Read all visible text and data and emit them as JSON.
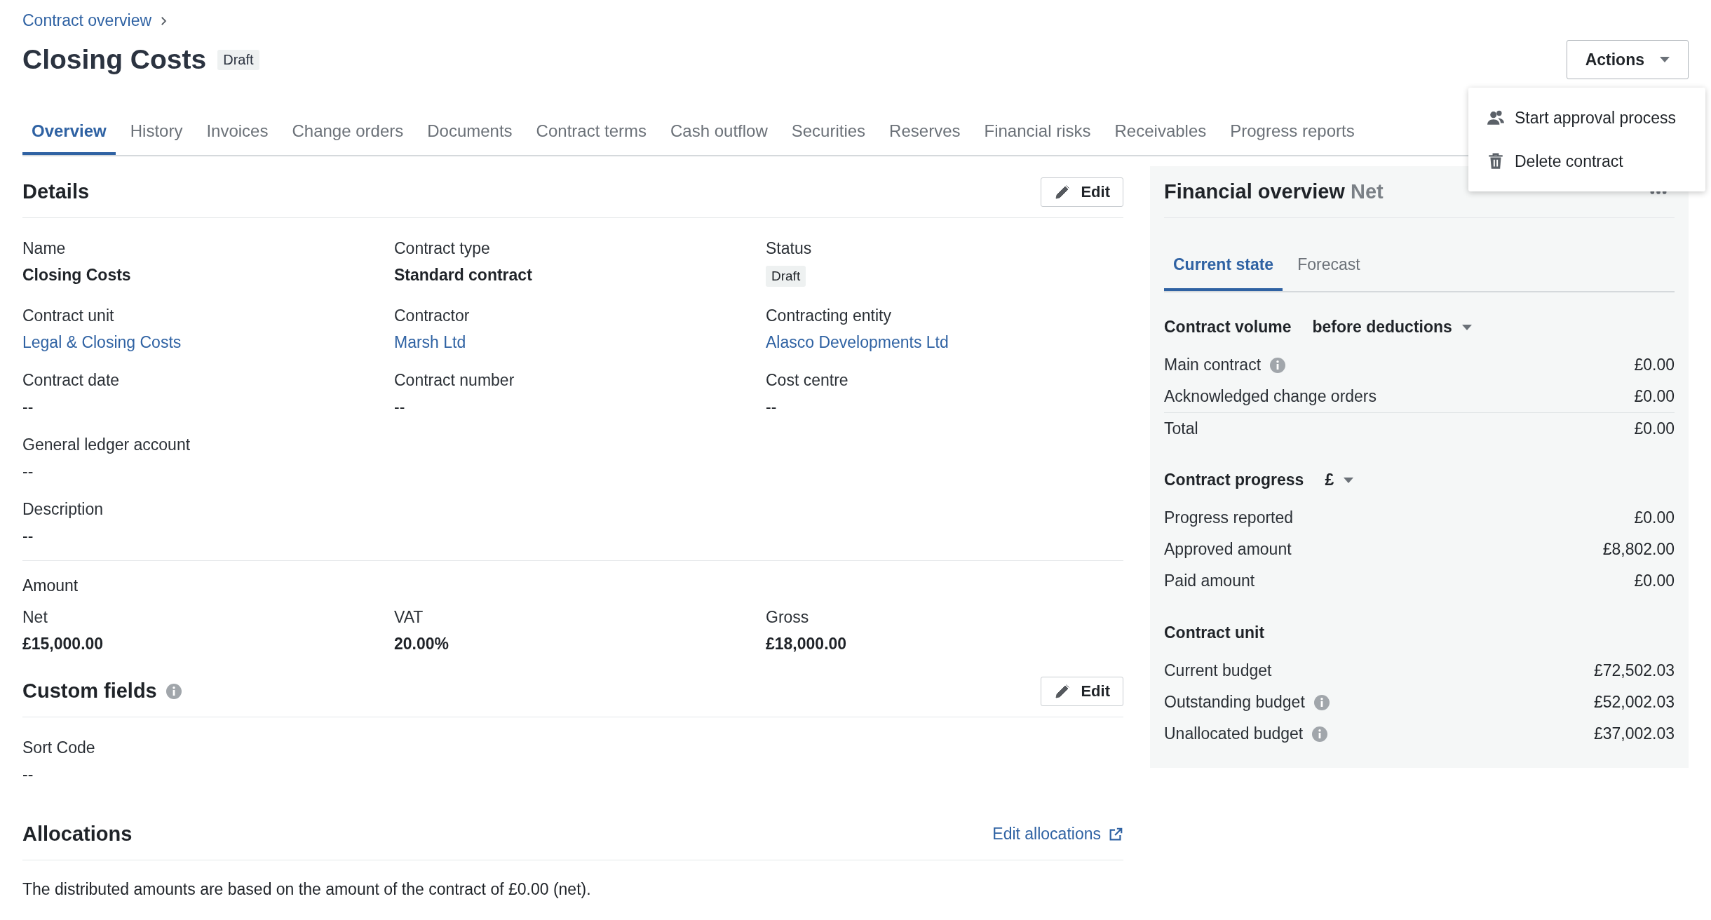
{
  "breadcrumb": {
    "label": "Contract overview"
  },
  "page_title": "Closing Costs",
  "status_badge": "Draft",
  "actions_button": {
    "label": "Actions",
    "expanded": true
  },
  "actions_menu": [
    {
      "label": "Start approval process",
      "kind": "approval"
    },
    {
      "label": "Delete contract",
      "kind": "delete"
    }
  ],
  "tabs": [
    {
      "label": "Overview",
      "selected": true
    },
    {
      "label": "History",
      "selected": false
    },
    {
      "label": "Invoices",
      "selected": false
    },
    {
      "label": "Change orders",
      "selected": false
    },
    {
      "label": "Documents",
      "selected": false
    },
    {
      "label": "Contract terms",
      "selected": false
    },
    {
      "label": "Cash outflow",
      "selected": false
    },
    {
      "label": "Securities",
      "selected": false
    },
    {
      "label": "Reserves",
      "selected": false
    },
    {
      "label": "Financial risks",
      "selected": false
    },
    {
      "label": "Receivables",
      "selected": false
    },
    {
      "label": "Progress reports",
      "selected": false
    }
  ],
  "details": {
    "title": "Details",
    "edit_label": "Edit",
    "rows": [
      [
        {
          "label": "Name",
          "value": "Closing Costs",
          "kind": "strong"
        },
        {
          "label": "Contract type",
          "value": "Standard contract",
          "kind": "strong"
        },
        {
          "label": "Status",
          "value": "Draft",
          "kind": "badge"
        }
      ],
      [
        {
          "label": "Contract unit",
          "value": "Legal & Closing Costs",
          "kind": "link"
        },
        {
          "label": "Contractor",
          "value": "Marsh Ltd",
          "kind": "link"
        },
        {
          "label": "Contracting entity",
          "value": "Alasco Developments Ltd",
          "kind": "link"
        }
      ],
      [
        {
          "label": "Contract date",
          "value": "--",
          "kind": "text"
        },
        {
          "label": "Contract number",
          "value": "--",
          "kind": "text"
        },
        {
          "label": "Cost centre",
          "value": "--",
          "kind": "text"
        }
      ],
      [
        {
          "label": "General ledger account",
          "value": "--",
          "kind": "text"
        }
      ],
      [
        {
          "label": "Description",
          "value": "--",
          "kind": "text"
        }
      ]
    ],
    "amount": {
      "title": "Amount",
      "fields": [
        {
          "label": "Net",
          "value": "£15,000.00",
          "kind": "strong"
        },
        {
          "label": "VAT",
          "value": "20.00%",
          "kind": "strong"
        },
        {
          "label": "Gross",
          "value": "£18,000.00",
          "kind": "strong"
        }
      ]
    }
  },
  "custom_fields": {
    "title": "Custom fields",
    "edit_label": "Edit",
    "fields": [
      {
        "label": "Sort Code",
        "value": "--"
      }
    ]
  },
  "allocations": {
    "title": "Allocations",
    "link": "Edit allocations",
    "text": "The distributed amounts are based on the amount of the contract of £0.00 (net)."
  },
  "financial_overview": {
    "title": "Financial overview",
    "qualifier": "Net",
    "tabs": [
      {
        "label": "Current state",
        "selected": true
      },
      {
        "label": "Forecast",
        "selected": false
      }
    ],
    "sections": [
      {
        "title": "Contract volume",
        "selector": "before deductions",
        "rows": [
          {
            "label": "Main contract",
            "value": "£0.00",
            "info": true,
            "kind": "line"
          },
          {
            "label": "Acknowledged change orders",
            "value": "£0.00",
            "info": false,
            "kind": "line"
          },
          {
            "label": "Total",
            "value": "£0.00",
            "info": false,
            "kind": "total"
          }
        ]
      },
      {
        "title": "Contract progress",
        "selector": "£",
        "rows": [
          {
            "label": "Progress reported",
            "value": "£0.00",
            "info": false,
            "kind": "line"
          },
          {
            "label": "Approved amount",
            "value": "£8,802.00",
            "info": false,
            "kind": "line"
          },
          {
            "label": "Paid amount",
            "value": "£0.00",
            "info": false,
            "kind": "line"
          }
        ]
      },
      {
        "title": "Contract unit",
        "rows": [
          {
            "label": "Current budget",
            "value": "£72,502.03",
            "info": false,
            "kind": "line"
          },
          {
            "label": "Outstanding budget",
            "value": "£52,002.03",
            "info": true,
            "kind": "line"
          },
          {
            "label": "Unallocated budget",
            "value": "£37,002.03",
            "info": true,
            "kind": "line"
          }
        ]
      }
    ]
  }
}
